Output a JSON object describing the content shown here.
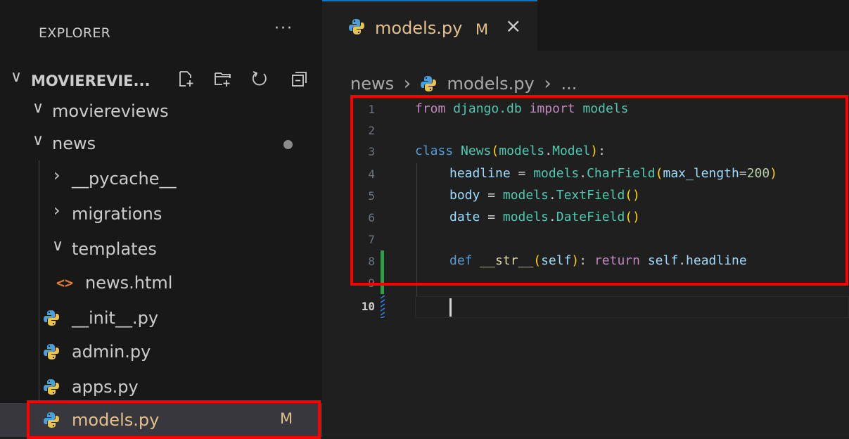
{
  "sidebar": {
    "title": "EXPLORER",
    "more": "···",
    "project": "MOVIEREVIE...",
    "tree": [
      {
        "label": "moviereviews",
        "type": "folder-open"
      },
      {
        "label": "news",
        "type": "folder-open"
      },
      {
        "label": "__pycache__",
        "type": "folder-closed"
      },
      {
        "label": "migrations",
        "type": "folder-closed"
      },
      {
        "label": "templates",
        "type": "folder-open"
      },
      {
        "label": "news.html",
        "type": "html-file"
      },
      {
        "label": "__init__.py",
        "type": "py-file"
      },
      {
        "label": "admin.py",
        "type": "py-file"
      },
      {
        "label": "apps.py",
        "type": "py-file"
      },
      {
        "label": "models.py",
        "type": "py-file",
        "badge": "M",
        "selected": true
      }
    ]
  },
  "tabs": [
    {
      "label": "models.py",
      "badge": "M",
      "close": "×"
    }
  ],
  "breadcrumb": {
    "folder": "news",
    "sep": "›",
    "file": "models.py",
    "more": "..."
  },
  "editor": {
    "line_numbers": [
      "1",
      "2",
      "3",
      "4",
      "5",
      "6",
      "7",
      "8",
      "9",
      "10"
    ],
    "line1": {
      "a": "from",
      "b": "django.db",
      "c": "import",
      "d": "models"
    },
    "line3": {
      "a": "class",
      "b": "News",
      "c": "(",
      "d": "models",
      "e": ".",
      "f": "Model",
      "g": ")",
      "h": ":"
    },
    "line4": {
      "a": "headline",
      "b": " = ",
      "c": "models",
      "d": ".",
      "e": "CharField",
      "f": "(",
      "g": "max_length",
      "h": "=",
      "i": "200",
      "j": ")"
    },
    "line5": {
      "a": "body",
      "b": " = ",
      "c": "models",
      "d": ".",
      "e": "TextField",
      "f": "()"
    },
    "line6": {
      "a": "date",
      "b": " = ",
      "c": "models",
      "d": ".",
      "e": "DateField",
      "f": "()"
    },
    "line8": {
      "a": "def",
      "b": "__str__",
      "c": "(",
      "d": "self",
      "e": ")",
      "f": ": ",
      "g": "return",
      "h": "self",
      "i": ".",
      "j": "headline"
    }
  },
  "colors": {
    "highlight_box": "#ff0000",
    "modified": "#e2c08d",
    "added_gutter": "#2ea043"
  }
}
